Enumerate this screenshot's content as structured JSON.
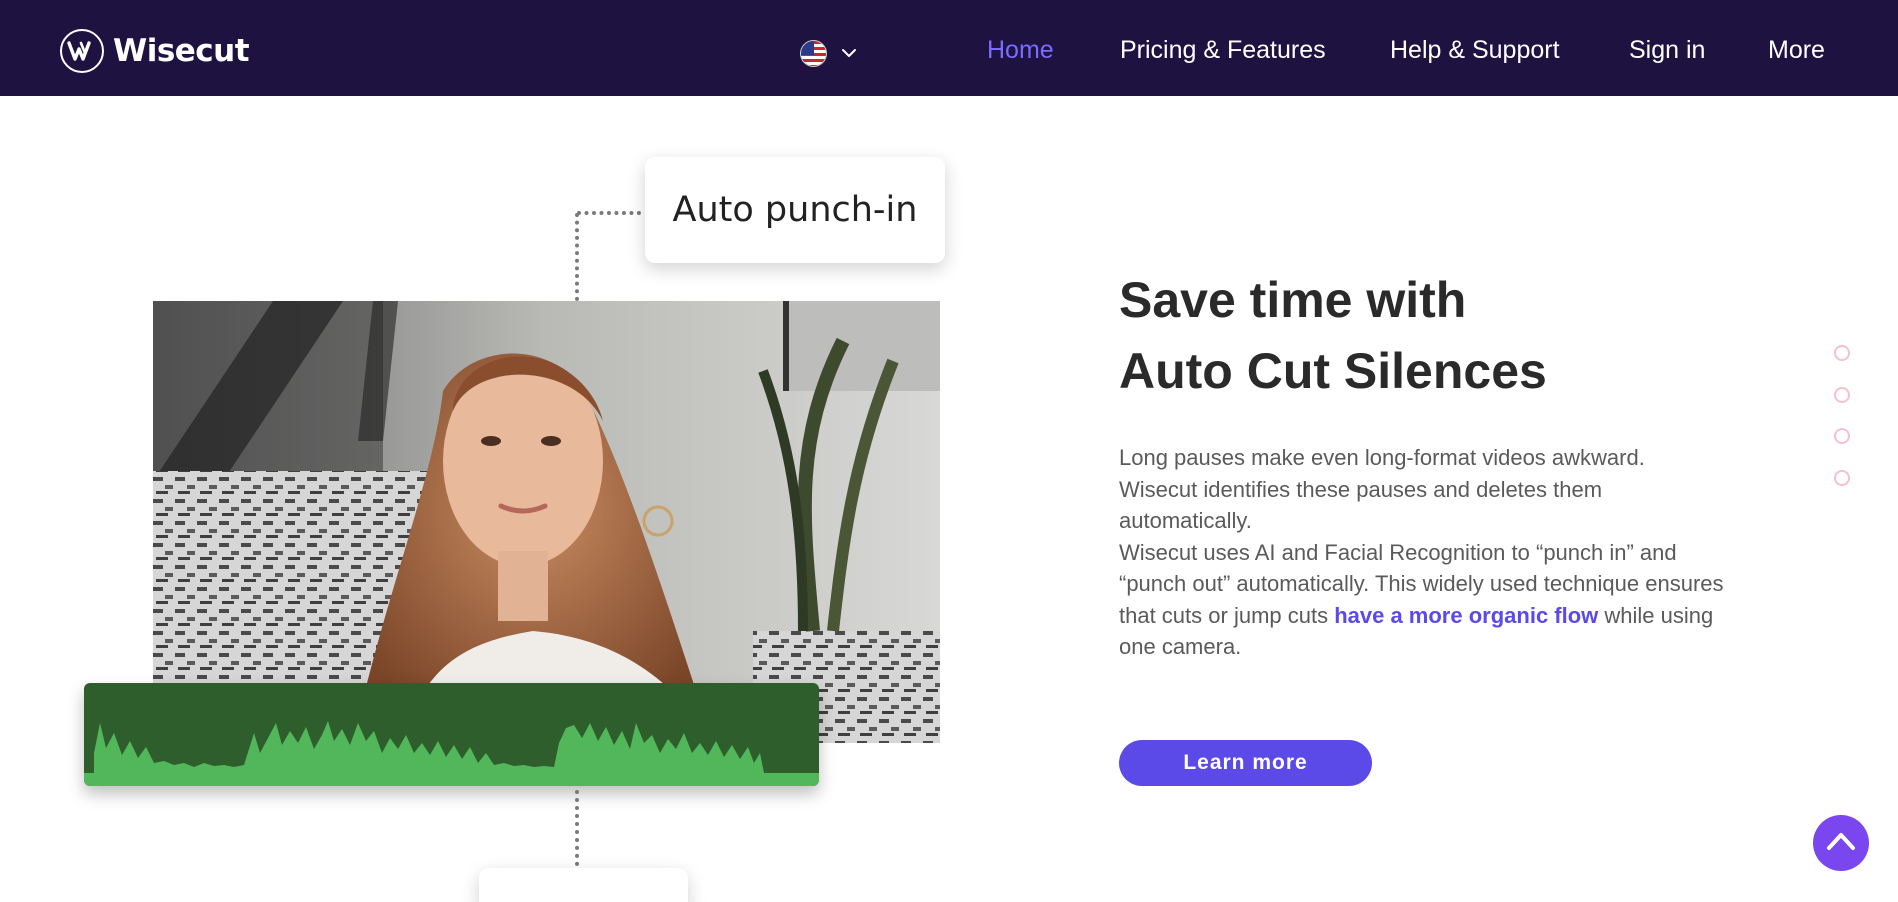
{
  "brand": {
    "name": "Wisecut",
    "logo_icon": "wisecut-w-logo-icon"
  },
  "header": {
    "language": {
      "flag_icon": "us-flag-icon",
      "chevron_icon": "chevron-down-icon"
    },
    "nav": [
      {
        "label": "Home",
        "active": true
      },
      {
        "label": "Pricing & Features",
        "active": false
      },
      {
        "label": "Help & Support",
        "active": false
      },
      {
        "label": "Sign in",
        "active": false
      },
      {
        "label": "More",
        "active": false
      }
    ]
  },
  "illustration": {
    "callout_top": "Auto punch-in",
    "callout_bottom": "",
    "waveform_colors": {
      "background": "#2d5e2c",
      "wave": "#52b75a"
    }
  },
  "feature": {
    "title_line1": "Save time with",
    "title_line2": "Auto Cut Silences",
    "paragraph_1": "Long pauses make even long-format videos awkward. Wisecut identifies these pauses and deletes them automatically.",
    "paragraph_2_start": "Wisecut uses AI and Facial Recognition to “punch in” and “punch out” automatically. This widely used technique ensures that cuts or jump cuts ",
    "paragraph_2_highlight": "have a more organic flow",
    "paragraph_2_end": " while using one camera.",
    "cta_label": "Learn more"
  },
  "pager": {
    "count": 4,
    "icon": "pager-dot-icon"
  },
  "scroll_top": {
    "icon": "chevron-up-icon"
  },
  "colors": {
    "header_bg": "#1d1240",
    "accent": "#5b4ae8",
    "nav_active": "#7a6cff",
    "scroll_top": "#7a46ef"
  }
}
